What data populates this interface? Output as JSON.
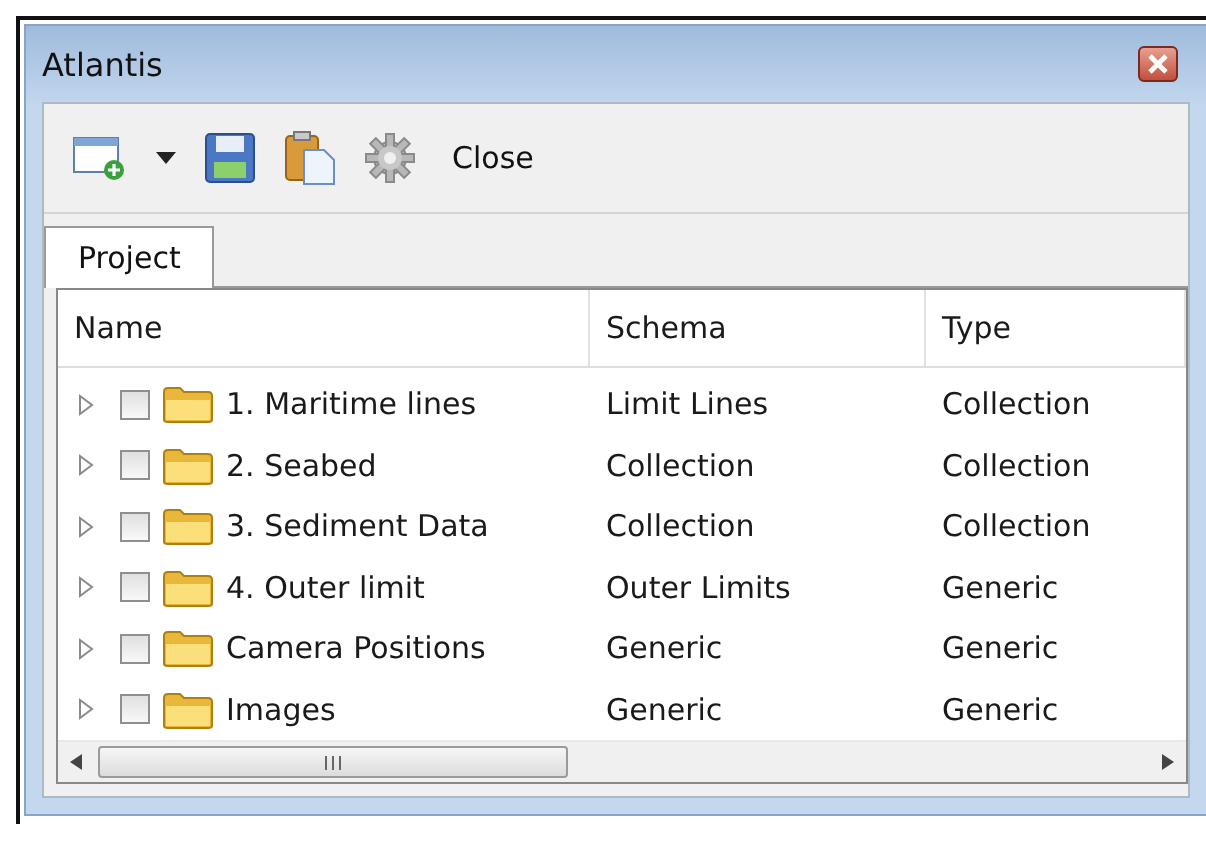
{
  "window": {
    "title": "Atlantis"
  },
  "toolbar": {
    "close_label": "Close"
  },
  "tabs": [
    {
      "label": "Project",
      "selected": true
    }
  ],
  "table": {
    "columns": [
      "Name",
      "Schema",
      "Type"
    ],
    "rows": [
      {
        "name": "1. Maritime lines",
        "schema": "Limit Lines",
        "type": "Collection",
        "checked": false,
        "expanded": false
      },
      {
        "name": "2. Seabed",
        "schema": "Collection",
        "type": "Collection",
        "checked": false,
        "expanded": false
      },
      {
        "name": "3. Sediment Data",
        "schema": "Collection",
        "type": "Collection",
        "checked": false,
        "expanded": false
      },
      {
        "name": "4. Outer limit",
        "schema": "Outer Limits",
        "type": "Generic",
        "checked": false,
        "expanded": false
      },
      {
        "name": "Camera Positions",
        "schema": "Generic",
        "type": "Generic",
        "checked": false,
        "expanded": false
      },
      {
        "name": "Images",
        "schema": "Generic",
        "type": "Generic",
        "checked": false,
        "expanded": false
      }
    ]
  }
}
